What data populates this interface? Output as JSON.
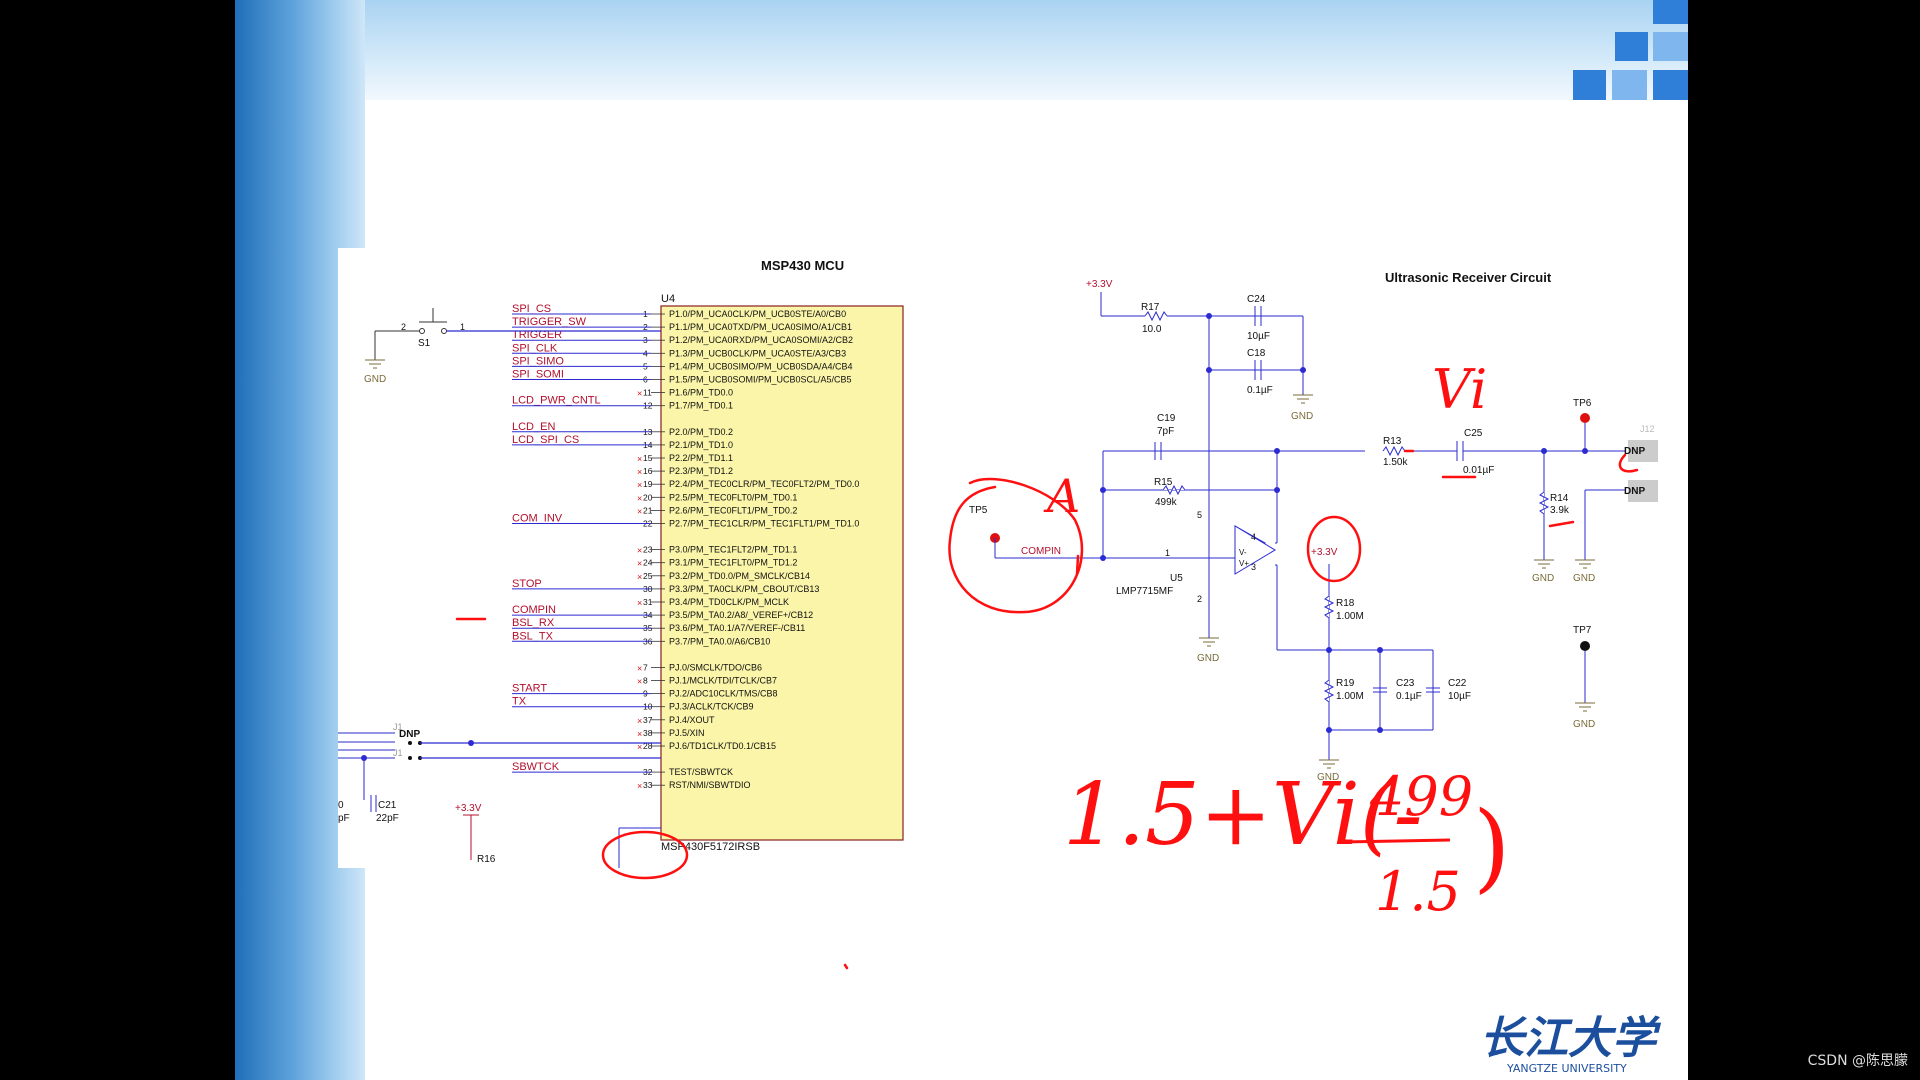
{
  "mcu": {
    "title": "MSP430 MCU",
    "ref": "U4",
    "part": "MSP430F5172IRSB",
    "pins": [
      {
        "num": "1",
        "name": "P1.0/PM_UCA0CLK/PM_UCB0STE/A0/CB0",
        "net": "SPI_CS"
      },
      {
        "num": "2",
        "name": "P1.1/PM_UCA0TXD/PM_UCA0SIMO/A1/CB1",
        "net": "TRIGGER_SW"
      },
      {
        "num": "3",
        "name": "P1.2/PM_UCA0RXD/PM_UCA0SOMI/A2/CB2",
        "net": "TRIGGER"
      },
      {
        "num": "4",
        "name": "P1.3/PM_UCB0CLK/PM_UCA0STE/A3/CB3",
        "net": "SPI_CLK"
      },
      {
        "num": "5",
        "name": "P1.4/PM_UCB0SIMO/PM_UCB0SDA/A4/CB4",
        "net": "SPI_SIMO"
      },
      {
        "num": "6",
        "name": "P1.5/PM_UCB0SOMI/PM_UCB0SCL/A5/CB5",
        "net": "SPI_SOMI"
      },
      {
        "num": "11",
        "name": "P1.6/PM_TD0.0",
        "net": ""
      },
      {
        "num": "12",
        "name": "P1.7/PM_TD0.1",
        "net": "LCD_PWR_CNTL"
      },
      {
        "num": "13",
        "name": "P2.0/PM_TD0.2",
        "net": "LCD_EN"
      },
      {
        "num": "14",
        "name": "P2.1/PM_TD1.0",
        "net": "LCD_SPI_CS"
      },
      {
        "num": "15",
        "name": "P2.2/PM_TD1.1",
        "net": ""
      },
      {
        "num": "16",
        "name": "P2.3/PM_TD1.2",
        "net": ""
      },
      {
        "num": "19",
        "name": "P2.4/PM_TEC0CLR/PM_TEC0FLT2/PM_TD0.0",
        "net": ""
      },
      {
        "num": "20",
        "name": "P2.5/PM_TEC0FLT0/PM_TD0.1",
        "net": ""
      },
      {
        "num": "21",
        "name": "P2.6/PM_TEC0FLT1/PM_TD0.2",
        "net": ""
      },
      {
        "num": "22",
        "name": "P2.7/PM_TEC1CLR/PM_TEC1FLT1/PM_TD1.0",
        "net": "COM_INV"
      },
      {
        "num": "23",
        "name": "P3.0/PM_TEC1FLT2/PM_TD1.1",
        "net": ""
      },
      {
        "num": "24",
        "name": "P3.1/PM_TEC1FLT0/PM_TD1.2",
        "net": ""
      },
      {
        "num": "25",
        "name": "P3.2/PM_TD0.0/PM_SMCLK/CB14",
        "net": ""
      },
      {
        "num": "30",
        "name": "P3.3/PM_TA0CLK/PM_CBOUT/CB13",
        "net": "STOP"
      },
      {
        "num": "31",
        "name": "P3.4/PM_TD0CLK/PM_MCLK",
        "net": ""
      },
      {
        "num": "34",
        "name": "P3.5/PM_TA0.2/A8/_VEREF+/CB12",
        "net": "COMPIN"
      },
      {
        "num": "35",
        "name": "P3.6/PM_TA0.1/A7/VEREF-/CB11",
        "net": "BSL_RX"
      },
      {
        "num": "36",
        "name": "P3.7/PM_TA0.0/A6/CB10",
        "net": "BSL_TX"
      },
      {
        "num": "7",
        "name": "PJ.0/SMCLK/TDO/CB6",
        "net": ""
      },
      {
        "num": "8",
        "name": "PJ.1/MCLK/TDI/TCLK/CB7",
        "net": ""
      },
      {
        "num": "9",
        "name": "PJ.2/ADC10CLK/TMS/CB8",
        "net": "START"
      },
      {
        "num": "10",
        "name": "PJ.3/ACLK/TCK/CB9",
        "net": "TX"
      },
      {
        "num": "37",
        "name": "PJ.4/XOUT",
        "net": ""
      },
      {
        "num": "38",
        "name": "PJ.5/XIN",
        "net": ""
      },
      {
        "num": "28",
        "name": "PJ.6/TD1CLK/TD0.1/CB15",
        "net": ""
      },
      {
        "num": "32",
        "name": "TEST/SBWTCK",
        "net": "SBWTCK"
      },
      {
        "num": "33",
        "name": "RST/NMI/SBWTDIO",
        "net": ""
      }
    ],
    "switch": {
      "ref": "S1",
      "pin2": "2",
      "pin1": "1",
      "gnd": "GND"
    },
    "crystal_dnp": "DNP",
    "crystal_refs": [
      "J1",
      "J1"
    ],
    "cap_c21": {
      "ref": "C21",
      "value": "22pF"
    },
    "cap_c20_partial": {
      "ref": "0",
      "value": "pF"
    },
    "supply": "+3.3V",
    "r16": "R16"
  },
  "rx": {
    "title": "Ultrasonic Receiver Circuit",
    "supply": "+3.3V",
    "gnd": "GND",
    "r17": {
      "ref": "R17",
      "value": "10.0"
    },
    "c24": {
      "ref": "C24",
      "value": "10µF"
    },
    "c18": {
      "ref": "C18",
      "value": "0.1µF"
    },
    "c19": {
      "ref": "C19",
      "value": "7pF"
    },
    "r15": {
      "ref": "R15",
      "value": "499k"
    },
    "r13": {
      "ref": "R13",
      "value": "1.50k"
    },
    "c25": {
      "ref": "C25",
      "value": "0.01µF"
    },
    "r14": {
      "ref": "R14",
      "value": "3.9k"
    },
    "r18": {
      "ref": "R18",
      "value": "1.00M"
    },
    "r19": {
      "ref": "R19",
      "value": "1.00M"
    },
    "c23": {
      "ref": "C23",
      "value": "0.1µF"
    },
    "c22": {
      "ref": "C22",
      "value": "10µF"
    },
    "tp5": "TP5",
    "tp6": "TP6",
    "tp7": "TP7",
    "compin": "COMPIN",
    "u5": {
      "ref": "U5",
      "part": "LMP7715MF"
    },
    "opamp_pins": {
      "out": "1",
      "vm": "V-",
      "vp": "V+",
      "pin4": "4",
      "pin3": "3",
      "pin5": "5",
      "pin2": "2"
    },
    "j12": "J12",
    "dnp": "DNP"
  },
  "annotations": {
    "vi": "Vi",
    "a": "A",
    "formula_left": "1.5+Vi(-",
    "formula_num": "499",
    "formula_den": "1.5",
    "formula_close": ")"
  },
  "logo": {
    "chars": "长江大学",
    "en": "YANGTZE UNIVERSITY"
  },
  "watermark": "CSDN @陈思朦",
  "colors": {
    "wire": "#2b2bd1",
    "net": "#b2102d",
    "pin": "#b2102d",
    "box": "#faf5a8",
    "ink": "#ff1010",
    "gnd": "#7a6b3a"
  }
}
